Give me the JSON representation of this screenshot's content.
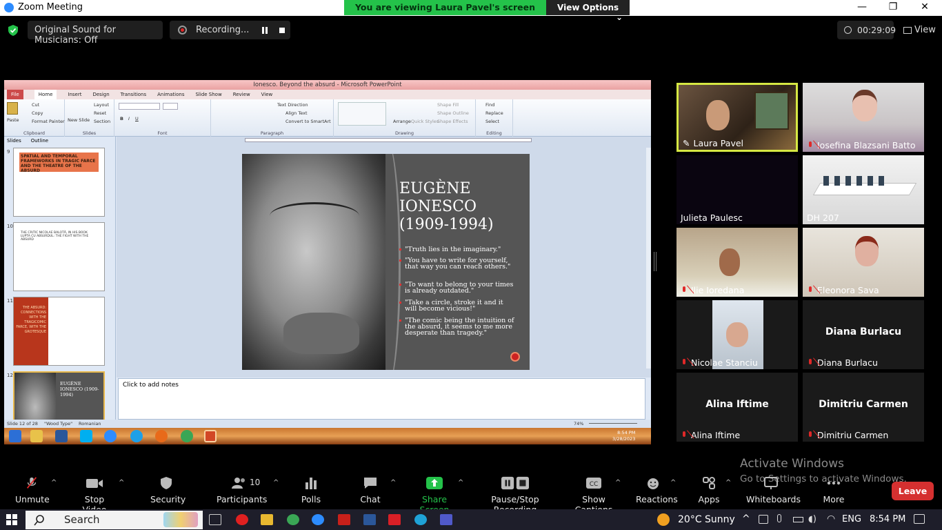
{
  "window": {
    "title": "Zoom Meeting",
    "minimize": "—",
    "restore": "❐",
    "close": "✕"
  },
  "banner": {
    "viewing": "You are viewing Laura Pavel's screen",
    "options": "View Options",
    "options_caret": "⌄"
  },
  "topbar": {
    "original_sound": "Original Sound for Musicians: Off",
    "recording": "Recording...",
    "timer": "00:29:09",
    "view": "View"
  },
  "powerpoint": {
    "title": "Ionesco. Beyond the absurd - Microsoft PowerPoint",
    "tabs": [
      "File",
      "Home",
      "Insert",
      "Design",
      "Transitions",
      "Animations",
      "Slide Show",
      "Review",
      "View"
    ],
    "ribbon": {
      "clipboard": "Clipboard",
      "paste": "Paste",
      "cut": "Cut",
      "copy": "Copy",
      "format_painter": "Format Painter",
      "slides": "Slides",
      "new_slide": "New Slide",
      "layout": "Layout",
      "reset": "Reset",
      "section": "Section",
      "font": "Font",
      "paragraph": "Paragraph",
      "text_direction": "Text Direction",
      "align_text": "Align Text",
      "smartart": "Convert to SmartArt",
      "drawing": "Drawing",
      "arrange": "Arrange",
      "quick_styles": "Quick Styles",
      "shape_fill": "Shape Fill",
      "shape_outline": "Shape Outline",
      "shape_effects": "Shape Effects",
      "editing": "Editing",
      "find": "Find",
      "replace": "Replace",
      "select": "Select"
    },
    "pane_tabs": [
      "Slides",
      "Outline"
    ],
    "thumbs": [
      {
        "num": "9",
        "title": "SPATIAL AND TEMPORAL FRAMEWORKS IN TRAGIC FARCE AND THE THEATRE OF THE ABSURD"
      },
      {
        "num": "10",
        "title": "THE CRITIC NICOLAE BALOTĂ, IN HIS BOOK LUPTA CU ABSURDUL: THE FIGHT WITH THE ABSURD"
      },
      {
        "num": "11",
        "title": "THE ABSURD: CONNECTIONS WITH THE TRAGICOMIC FARCE, WITH THE GROTESQUE"
      },
      {
        "num": "12",
        "title": "EUGÈNE IONESCO (1909-1994)"
      }
    ],
    "slide": {
      "name_line1": "EUGÈNE",
      "name_line2": "IONESCO",
      "name_line3": "(1909-1994)",
      "quotes": [
        "\"Truth lies in the imaginary.\"",
        "\"You have to write for yourself, that way you can reach others.\"",
        "\"To want to belong to your times is already outdated.\"",
        "\"Take a circle, stroke it and it will become vicious!\"",
        "\"The comic being the intuition of the absurd, it seems to me more desperate than tragedy.\""
      ]
    },
    "notes_placeholder": "Click to add notes",
    "status": {
      "slide": "Slide 12 of 28",
      "theme": "\"Wood Type\"",
      "language": "Romanian",
      "zoom": "74%"
    },
    "taskbar_clock": {
      "time": "8:54 PM",
      "date": "3/28/2023"
    }
  },
  "participants": [
    {
      "name": "Laura Pavel",
      "muted": false,
      "active": true
    },
    {
      "name": "Iosefina Blazsani Batto",
      "muted": true
    },
    {
      "name": "Julieta Paulesc",
      "muted": false
    },
    {
      "name": "DH 207",
      "muted": false
    },
    {
      "name": "Ilie Ioredana",
      "muted": true
    },
    {
      "name": "Eleonora Sava",
      "muted": true
    },
    {
      "name": "Nicolae Stanciu",
      "muted": true
    },
    {
      "name": "Diana Burlacu",
      "muted": true,
      "big": "Diana Burlacu"
    },
    {
      "name": "Alina Iftime",
      "muted": true,
      "big": "Alina Iftime"
    },
    {
      "name": "Dimitriu Carmen",
      "muted": true,
      "big": "Dimitriu Carmen"
    }
  ],
  "toolbar": {
    "unmute": "Unmute",
    "stop_video": "Stop Video",
    "security": "Security",
    "participants": "Participants",
    "participants_count": "10",
    "polls": "Polls",
    "chat": "Chat",
    "share_screen": "Share Screen",
    "pause_recording": "Pause/Stop Recording",
    "captions": "Show Captions",
    "reactions": "Reactions",
    "apps": "Apps",
    "whiteboards": "Whiteboards",
    "more": "More",
    "leave": "Leave",
    "caret": "^"
  },
  "activate": {
    "line1": "Activate Windows",
    "line2": "Go to Settings to activate Windows."
  },
  "win_taskbar": {
    "search": "Search",
    "weather": "20°C  Sunny",
    "lang": "ENG",
    "time": "8:54 PM"
  },
  "colors": {
    "accent_green": "#24c24a",
    "leave_red": "#d53030",
    "active_speaker": "#d6e843",
    "mute_red": "#e02828"
  }
}
